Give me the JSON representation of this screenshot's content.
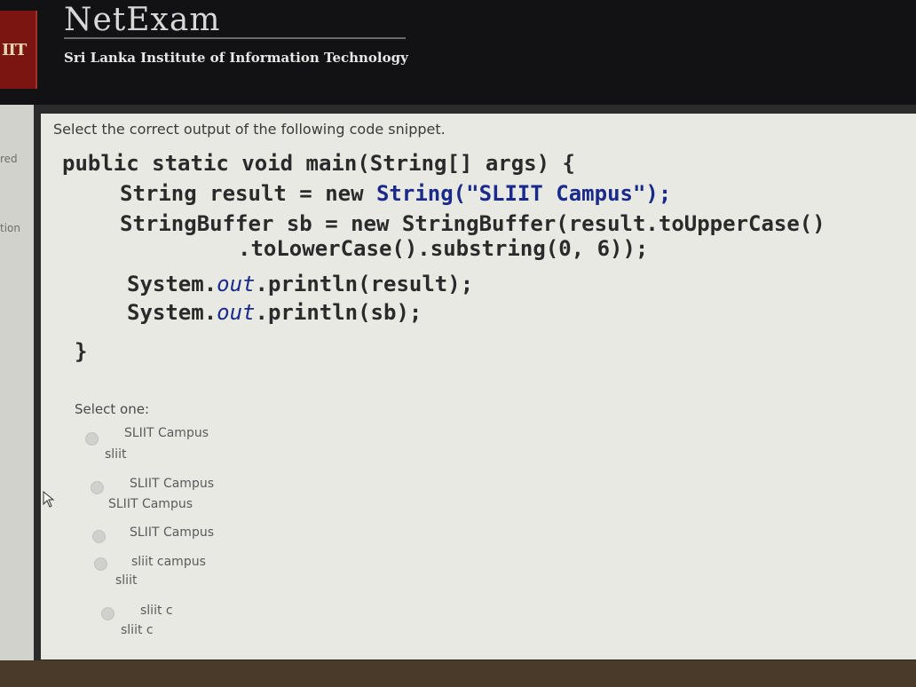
{
  "app": {
    "title": "NetExam",
    "org": "Sri Lanka Institute of Information Technology",
    "logo_text": "IIT"
  },
  "left_nav": {
    "items": [
      "red",
      "tion"
    ]
  },
  "question": {
    "prompt": "Select the correct output of the following code snippet.",
    "code": {
      "line1": "public static void main(String[] args) {",
      "line2_a": "String result = new ",
      "line2_b": "String(\"SLIIT Campus\");",
      "line3": "StringBuffer sb = new StringBuffer(result.toUpperCase()",
      "line4": ".toLowerCase().substring(0, 6));",
      "line5_a": "System.",
      "line5_b": "out",
      "line5_c": ".println(result);",
      "line6_a": "System.",
      "line6_b": "out",
      "line6_c": ".println(sb);",
      "line7": "}"
    },
    "select_label": "Select one:",
    "options": [
      {
        "line1": "SLIIT Campus",
        "line2": "sliit"
      },
      {
        "line1": "SLIIT Campus",
        "line2": "SLIIT Campus"
      },
      {
        "line1": "SLIIT Campus",
        "line2": ""
      },
      {
        "line1": "sliit campus",
        "line2": "sliit"
      },
      {
        "line1": "sliit c",
        "line2": "sliit c"
      }
    ]
  }
}
